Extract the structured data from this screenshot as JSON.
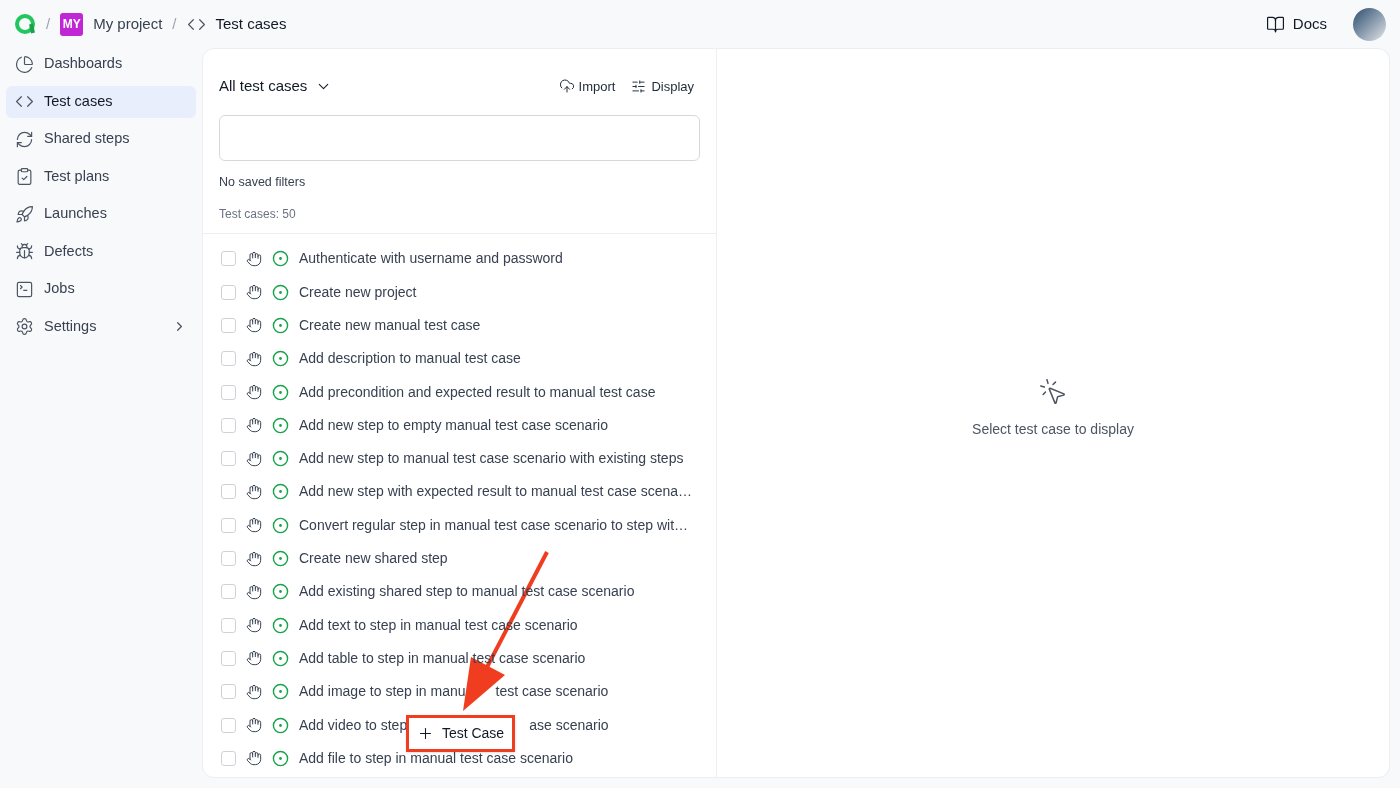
{
  "breadcrumb": {
    "project_badge": "MY",
    "project": "My project",
    "page": "Test cases",
    "separators": [
      "/",
      "/"
    ]
  },
  "header": {
    "docs": "Docs"
  },
  "sidebar": {
    "items": [
      {
        "label": "Dashboards",
        "selected": false
      },
      {
        "label": "Test cases",
        "selected": true
      },
      {
        "label": "Shared steps",
        "selected": false
      },
      {
        "label": "Test plans",
        "selected": false
      },
      {
        "label": "Launches",
        "selected": false
      },
      {
        "label": "Defects",
        "selected": false
      },
      {
        "label": "Jobs",
        "selected": false
      },
      {
        "label": "Settings",
        "selected": false,
        "expandable": true
      }
    ]
  },
  "list_panel": {
    "view": "All test cases",
    "actions": [
      "Import",
      "Display"
    ],
    "saved_filters": "No saved filters",
    "count": "Test cases: 50",
    "rows": [
      {
        "title": "Authenticate with username and password",
        "checked": false
      },
      {
        "title": "Create new project",
        "checked": false
      },
      {
        "title": "Create new manual test case",
        "checked": false
      },
      {
        "title": "Add description to manual test case",
        "checked": false
      },
      {
        "title": "Add precondition and expected result to manual test case",
        "checked": false
      },
      {
        "title": "Add new step to empty manual test case scenario",
        "checked": false
      },
      {
        "title": "Add new step to manual test case scenario with existing steps",
        "checked": false
      },
      {
        "title": "Add new step with expected result to manual test case scena…",
        "checked": false
      },
      {
        "title": "Convert regular step in manual test case scenario to step wit…",
        "checked": false
      },
      {
        "title": "Create new shared step",
        "checked": false
      },
      {
        "title": "Add existing shared step to manual test case scenario",
        "checked": false
      },
      {
        "title": "Add text to step in manual test case scenario",
        "checked": false
      },
      {
        "title": "Add table to step in manual test case scenario",
        "checked": false
      },
      {
        "title_parts": [
          "Add image to step in manu",
          "test case scenario"
        ],
        "checked": false
      },
      {
        "title_parts": [
          "Add video to step",
          "ase scenario"
        ],
        "checked": false
      },
      {
        "title": "Add file to step in manual test case scenario",
        "checked": false
      }
    ],
    "new_button": "Test Case"
  },
  "detail_panel": {
    "empty_message": "Select test case to display"
  }
}
